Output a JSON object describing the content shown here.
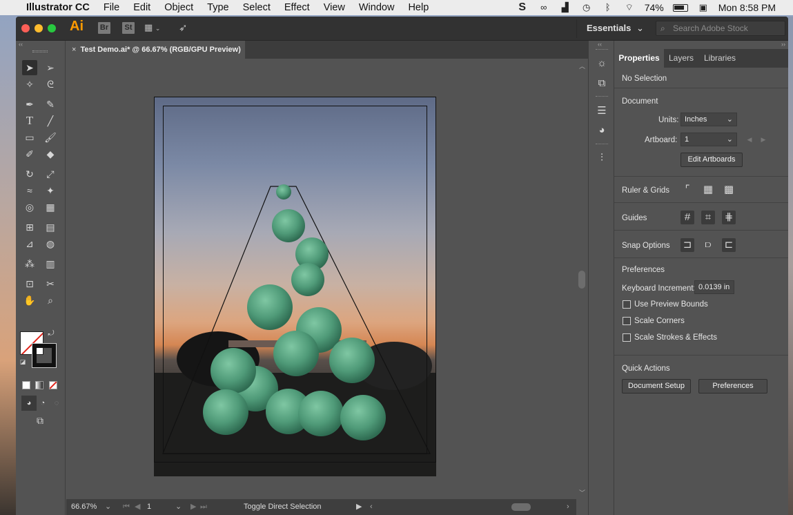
{
  "menubar": {
    "app_name": "Illustrator CC",
    "items": [
      "File",
      "Edit",
      "Object",
      "Type",
      "Select",
      "Effect",
      "View",
      "Window",
      "Help"
    ],
    "battery": "74%",
    "clock": "Mon 8:58 PM"
  },
  "titlebar": {
    "app_logo": "Ai",
    "bridge_badge": "Br",
    "stock_badge": "St",
    "workspace": "Essentials",
    "stock_search_placeholder": "Search Adobe Stock"
  },
  "document": {
    "tab_title": "Test Demo.ai* @ 66.67% (RGB/GPU Preview)"
  },
  "statusbar": {
    "zoom": "66.67%",
    "artboard_number": "1",
    "message": "Toggle Direct Selection"
  },
  "properties": {
    "tabs": [
      "Properties",
      "Layers",
      "Libraries"
    ],
    "active_tab": "Properties",
    "selection_state": "No Selection",
    "document_heading": "Document",
    "units_label": "Units:",
    "units_value": "Inches",
    "artboard_label": "Artboard:",
    "artboard_value": "1",
    "edit_artboards_button": "Edit Artboards",
    "ruler_grids_label": "Ruler & Grids",
    "guides_label": "Guides",
    "snap_options_label": "Snap Options",
    "preferences_heading": "Preferences",
    "keyboard_increment_label": "Keyboard Increment:",
    "keyboard_increment_value": "0.0139 in",
    "use_preview_bounds": "Use Preview Bounds",
    "scale_corners": "Scale Corners",
    "scale_strokes_effects": "Scale Strokes & Effects",
    "quick_actions_heading": "Quick Actions",
    "document_setup_button": "Document Setup",
    "preferences_button": "Preferences"
  },
  "colors": {
    "accent_orange": "#ff9a00",
    "panel_bg": "#535353",
    "sphere_green": "#5aa382"
  },
  "icons": {
    "tools": [
      "selection-tool",
      "direct-selection-tool",
      "magic-wand-tool",
      "lasso-tool",
      "pen-tool",
      "curvature-tool",
      "type-tool",
      "line-tool",
      "rectangle-tool",
      "paintbrush-tool",
      "shaper-tool",
      "eraser-tool",
      "rotate-tool",
      "scale-tool",
      "width-tool",
      "puppet-warp-tool",
      "shape-builder-tool",
      "perspective-grid-tool",
      "mesh-tool",
      "gradient-tool",
      "eyedropper-tool",
      "blend-tool",
      "symbol-sprayer-tool",
      "column-graph-tool",
      "artboard-tool",
      "slice-tool",
      "hand-tool",
      "zoom-tool"
    ]
  }
}
